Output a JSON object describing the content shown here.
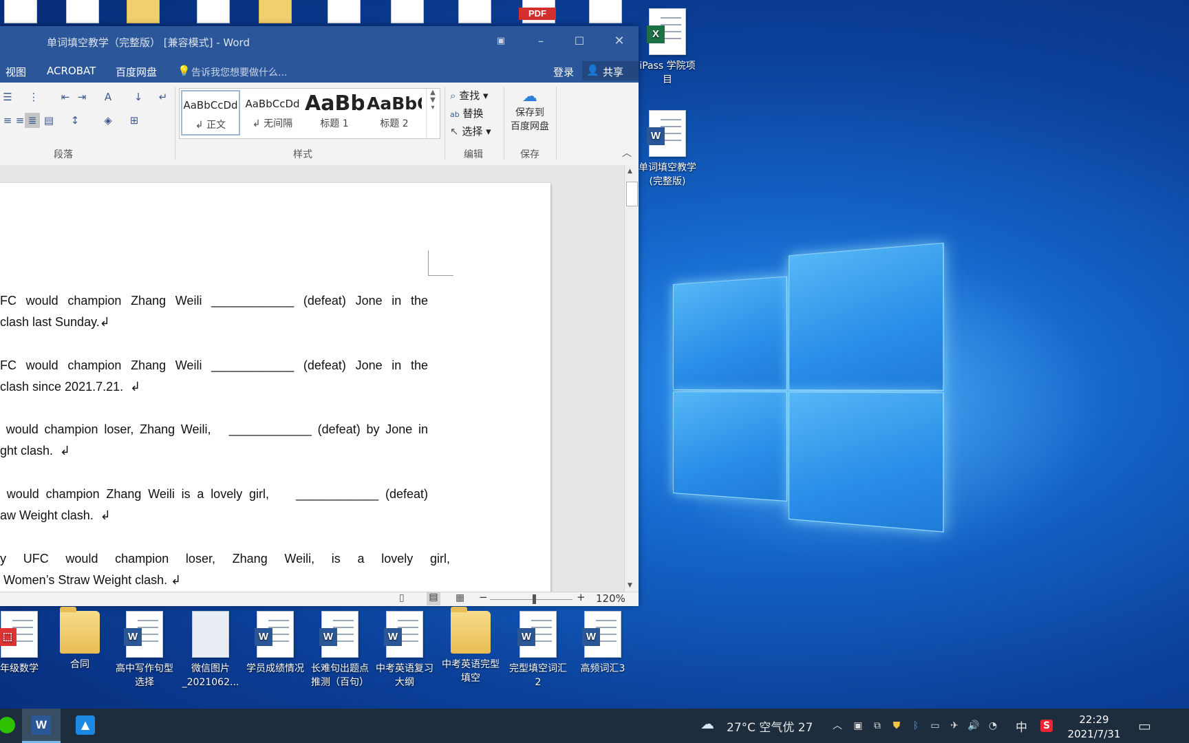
{
  "window": {
    "title": "单词填空教学（完整版） [兼容模式] - Word",
    "menu": [
      "视图",
      "ACROBAT",
      "百度网盘"
    ],
    "tell_me": "告诉我您想要做什么...",
    "login": "登录",
    "share": "共享"
  },
  "ribbon": {
    "groups": {
      "paragraph": "段落",
      "styles": "样式",
      "editing": "编辑",
      "save": "保存"
    },
    "styles": [
      {
        "preview": "AaBbCcDd",
        "name": "↲ 正文"
      },
      {
        "preview": "AaBbCcDd",
        "name": "↲ 无间隔"
      },
      {
        "preview": "AaBb",
        "name": "标题 1"
      },
      {
        "preview": "AaBbC",
        "name": "标题 2"
      }
    ],
    "editing": {
      "find": "查找",
      "replace": "替换",
      "select": "选择"
    },
    "baidu_save": {
      "line1": "保存到",
      "line2": "百度网盘"
    }
  },
  "document": {
    "paragraphs": [
      {
        "l1": "FC would champion Zhang Weili ____________ (defeat) Jone in the",
        "l2": "clash last Sunday.↲"
      },
      {
        "l1": "FC would champion Zhang Weili ____________ (defeat) Jone in the",
        "l2": "clash since 2021.7.21.  ↲"
      },
      {
        "l1": " would champion loser, Zhang Weili,   ____________ (defeat) by Jone in",
        "l2": "ght clash.  ↲"
      },
      {
        "l1": " would champion Zhang Weili is a lovely girl,    ____________ (defeat)",
        "l2": "aw Weight clash.  ↲"
      },
      {
        "l1": "y UFC would champion loser, Zhang Weili, is a lovely girl,",
        "l2": " Women’s Straw Weight clash. ↲"
      }
    ]
  },
  "status": {
    "zoom": "120%"
  },
  "desktop_icons": [
    {
      "label": "iPass 学院项\n目",
      "type": "excel"
    },
    {
      "label": "单词填空教学\n(完整版)",
      "type": "word"
    }
  ],
  "bottom_icons": [
    {
      "label": "年级数学",
      "type": "pdf"
    },
    {
      "label": "合同",
      "type": "folder"
    },
    {
      "label": "高中写作句型\n选择",
      "type": "word"
    },
    {
      "label": "微信图片\n_2021062...",
      "type": "image"
    },
    {
      "label": "学员成绩情况",
      "type": "word"
    },
    {
      "label": "长难句出题点\n推测（百句）",
      "type": "word"
    },
    {
      "label": "中考英语复习\n大纲",
      "type": "word"
    },
    {
      "label": "中考英语完型\n填空",
      "type": "pdf-folder"
    },
    {
      "label": "完型填空词汇\n2",
      "type": "word"
    },
    {
      "label": "高频词汇3",
      "type": "word"
    }
  ],
  "taskbar": {
    "weather": "27°C 空气优 27",
    "ime": "中",
    "time": "22:29",
    "date": "2021/7/31"
  },
  "colors": {
    "word_blue": "#2b579a",
    "taskbar": "#1d2d3d"
  }
}
